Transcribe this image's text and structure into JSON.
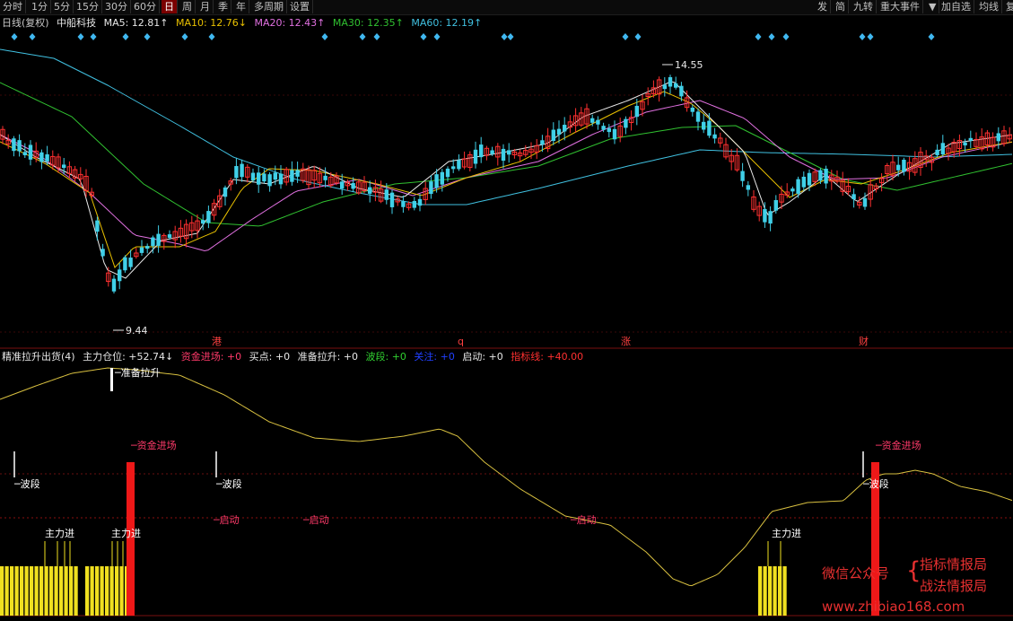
{
  "toolbar": {
    "periods": [
      "分时",
      "1分",
      "5分",
      "15分",
      "30分",
      "60分",
      "日",
      "周",
      "月",
      "季",
      "年",
      "多周期",
      "设置"
    ],
    "active_period": "日",
    "right_buttons": [
      "发",
      "简",
      "九转",
      "重大事件",
      "加自选",
      "均线",
      "复"
    ]
  },
  "header": {
    "label": "日线(复权)",
    "stock_name": "中船科技",
    "ma5": {
      "label": "MA5: 12.81↑",
      "color": "#e8e8e8"
    },
    "ma10": {
      "label": "MA10: 12.76↓",
      "color": "#e8c000"
    },
    "ma20": {
      "label": "MA20: 12.43↑",
      "color": "#e070e0"
    },
    "ma30": {
      "label": "MA30: 12.35↑",
      "color": "#30c030"
    },
    "ma60": {
      "label": "MA60: 12.19↑",
      "color": "#40c0e0"
    }
  },
  "main_chart": {
    "max_label": "14.55",
    "min_label": "9.44",
    "event_markers": [
      "港",
      "q",
      "涨",
      "财"
    ],
    "marker_color": "#40b8f0"
  },
  "indicator": {
    "title": "精准拉升出货(4)",
    "items": [
      {
        "label": "主力仓位: +52.74↓",
        "color": "#e8e8e8"
      },
      {
        "label": "资金进场: +0",
        "color": "#ff3a6a"
      },
      {
        "label": "买点: +0",
        "color": "#e8e8e8"
      },
      {
        "label": "准备拉升: +0",
        "color": "#e8e8e8"
      },
      {
        "label": "波段: +0",
        "color": "#30d030"
      },
      {
        "label": "关注: +0",
        "color": "#2040ff"
      },
      {
        "label": "启动: +0",
        "color": "#e8e8e8"
      },
      {
        "label": "指标线: +40.00",
        "color": "#ff3030"
      }
    ],
    "labels": {
      "ready": "准备拉升",
      "capital": "资金进场",
      "wave": "波段",
      "start": "启动",
      "main_in": "主力进"
    }
  },
  "watermark": {
    "wechat": "微信公众号",
    "line1": "指标情报局",
    "line2": "战法情报局",
    "url": "www.zhibiao168.com"
  }
}
